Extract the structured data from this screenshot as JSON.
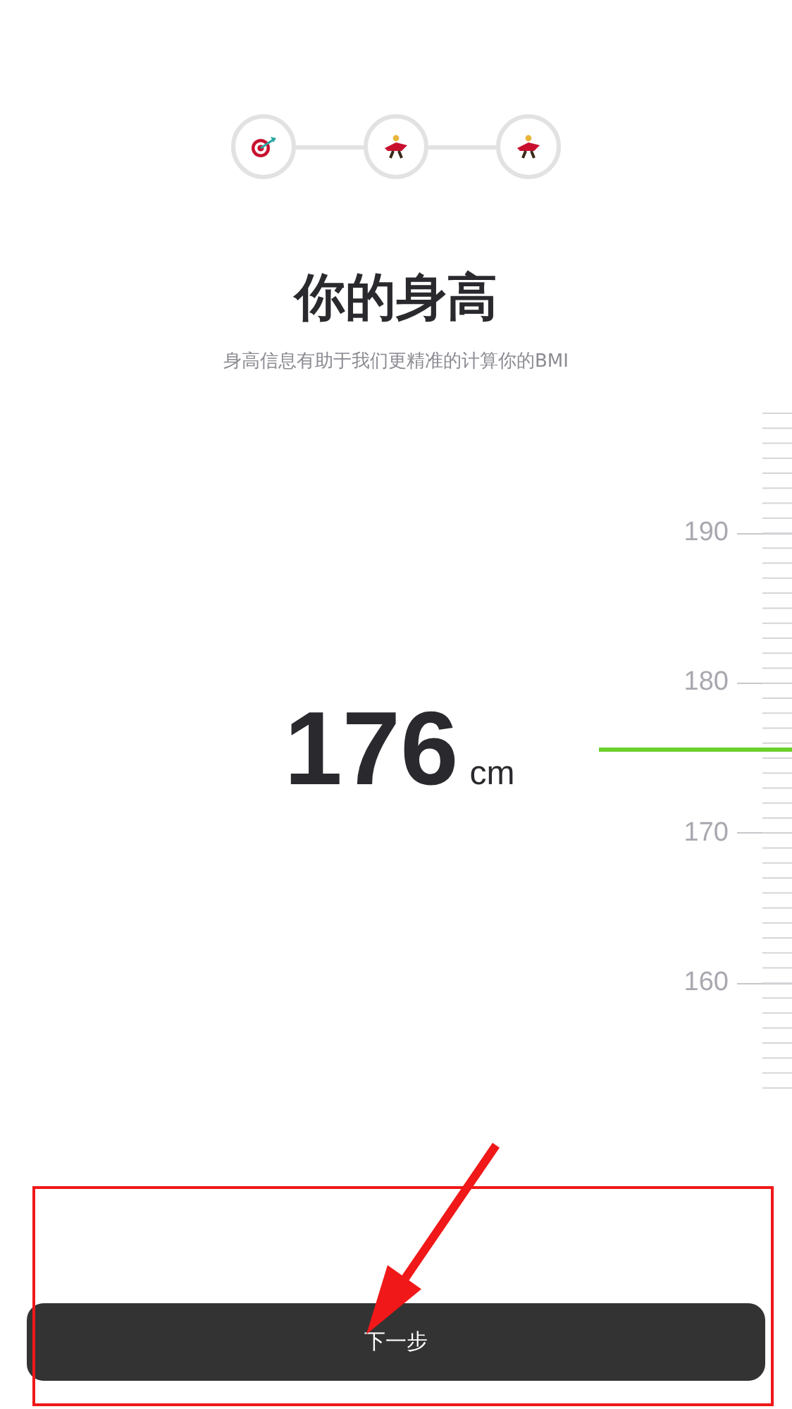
{
  "steps": [
    {
      "kind": "target"
    },
    {
      "kind": "figure"
    },
    {
      "kind": "figure"
    }
  ],
  "title": "你的身高",
  "subtitle": "身高信息有助于我们更精准的计算你的BMI",
  "height": {
    "value": "176",
    "unit": "cm"
  },
  "ruler": {
    "labels": [
      "190",
      "180",
      "170",
      "160"
    ]
  },
  "next_button": "下一步"
}
